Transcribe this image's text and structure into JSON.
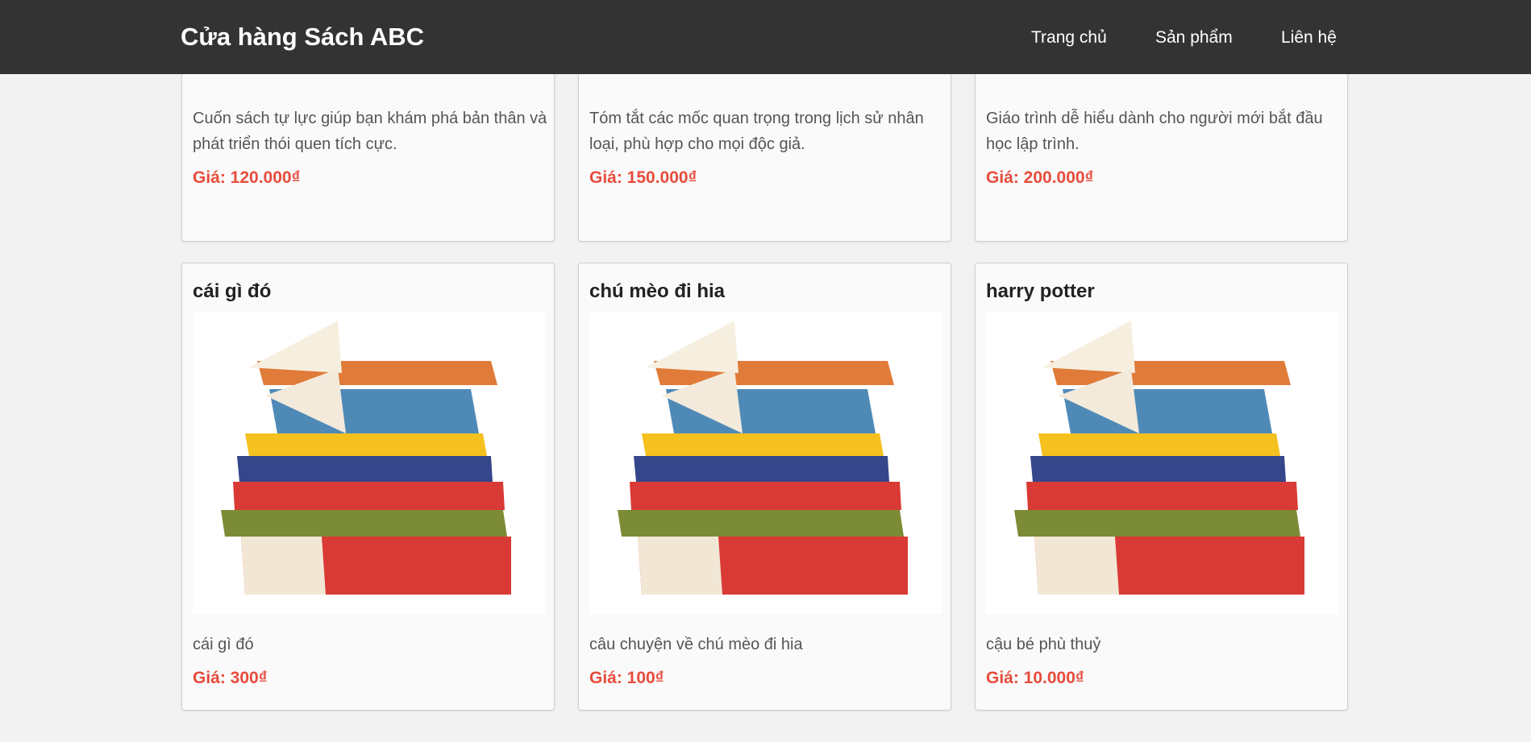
{
  "header": {
    "brand": "Cửa hàng Sách ABC",
    "nav": [
      "Trang chủ",
      "Sản phẩm",
      "Liên hệ"
    ],
    "bg_color": "#333333"
  },
  "price_color": "#e74c3c",
  "products_top": [
    {
      "description": "Cuốn sách tự lực giúp bạn khám phá bản thân và phát triển thói quen tích cực.",
      "price": "Giá: 120.000₫"
    },
    {
      "description": "Tóm tắt các mốc quan trọng trong lịch sử nhân loại, phù hợp cho mọi độc giả.",
      "price": "Giá: 150.000₫"
    },
    {
      "description": "Giáo trình dễ hiểu dành cho người mới bắt đầu học lập trình.",
      "price": "Giá: 200.000₫"
    }
  ],
  "products_bottom": [
    {
      "title": "cái gì đó",
      "description": "cái gì đó",
      "price": "Giá: 300₫"
    },
    {
      "title": "chú mèo đi hia",
      "description": "câu chuyện về chú mèo đi hia",
      "price": "Giá: 100₫"
    },
    {
      "title": "harry potter",
      "description": "cậu bé phù thuỷ",
      "price": "Giá: 10.000₫"
    }
  ]
}
